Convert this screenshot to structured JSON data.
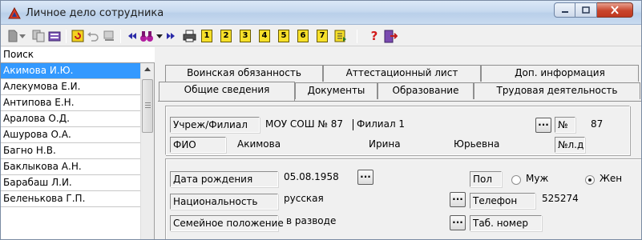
{
  "window": {
    "title": "Личное дело сотрудника",
    "title_icon": "red-triangle-app-icon",
    "controls": [
      "minimize",
      "maximize",
      "close"
    ]
  },
  "toolbar": {
    "page_buttons": [
      "1",
      "2",
      "3",
      "4",
      "5",
      "6",
      "7"
    ],
    "help_label": "?"
  },
  "left_panel": {
    "search_label": "Поиск",
    "employees": [
      "Акимова И.Ю.",
      "Алекумова Е.И.",
      "Антипова Е.Н.",
      "Аралова О.Д.",
      "Ашурова О.А.",
      "Багно Н.В.",
      "Баклыкова А.Н.",
      "Барабаш Л.И.",
      "Беленькова Г.П."
    ],
    "selected_index": 0
  },
  "tabs": {
    "row1": [
      "Воинская обязанность",
      "Аттестационный лист",
      "Доп. информация"
    ],
    "row2": [
      "Общие сведения",
      "Документы",
      "Образование",
      "Трудовая деятельность"
    ],
    "active": "Общие сведения"
  },
  "form": {
    "institution_label": "Учреж/Филиал",
    "institution_value": "МОУ СОШ № 87",
    "branch_value": "Филиал 1",
    "number_label": "№",
    "number_value": "87",
    "fio_label": "ФИО",
    "last_name": "Акимова",
    "first_name": "Ирина",
    "patronymic": "Юрьевна",
    "personal_file_label": "№л.д",
    "birth_date_label": "Дата рождения",
    "birth_date_value": "05.08.1958",
    "gender_label": "Пол",
    "gender_male": "Муж",
    "gender_female": "Жен",
    "gender_selected": "Жен",
    "nationality_label": "Национальность",
    "nationality_value": "русская",
    "phone_label": "Телефон",
    "phone_value": "525274",
    "marital_label": "Семейное положение",
    "marital_value": "в разводе",
    "tab_number_label": "Таб. номер",
    "ellipsis": "..."
  }
}
